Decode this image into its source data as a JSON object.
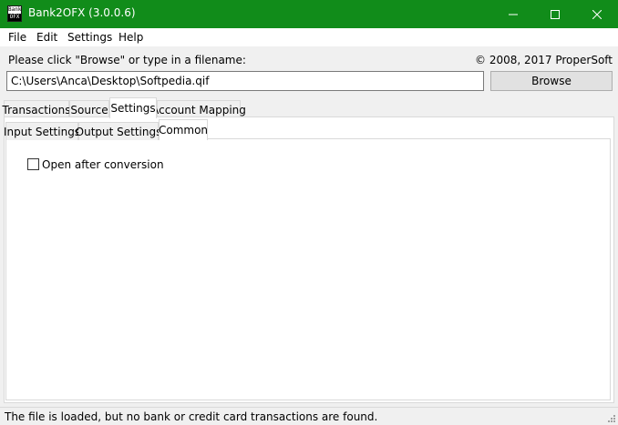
{
  "window": {
    "title": "Bank2OFX (3.0.0.6)",
    "icon_top": "Bank",
    "icon_bottom": "OFX",
    "accent": "#118c1a"
  },
  "menu": [
    "File",
    "Edit",
    "Settings",
    "Help"
  ],
  "form": {
    "prompt": "Please click \"Browse\" or type in a filename:",
    "copyright": "© 2008, 2017 ProperSoft",
    "filename": "C:\\Users\\Anca\\Desktop\\Softpedia.qif",
    "browse_label": "Browse"
  },
  "tabs": [
    "Transactions",
    "Source",
    "Settings",
    "Account Mapping"
  ],
  "subtabs": [
    "Input Settings",
    "Output Settings",
    "Common"
  ],
  "options": {
    "open_after_conversion": "Open after conversion",
    "open_after_conversion_checked": false
  },
  "status": "The file is loaded, but no bank or credit card transactions are found."
}
